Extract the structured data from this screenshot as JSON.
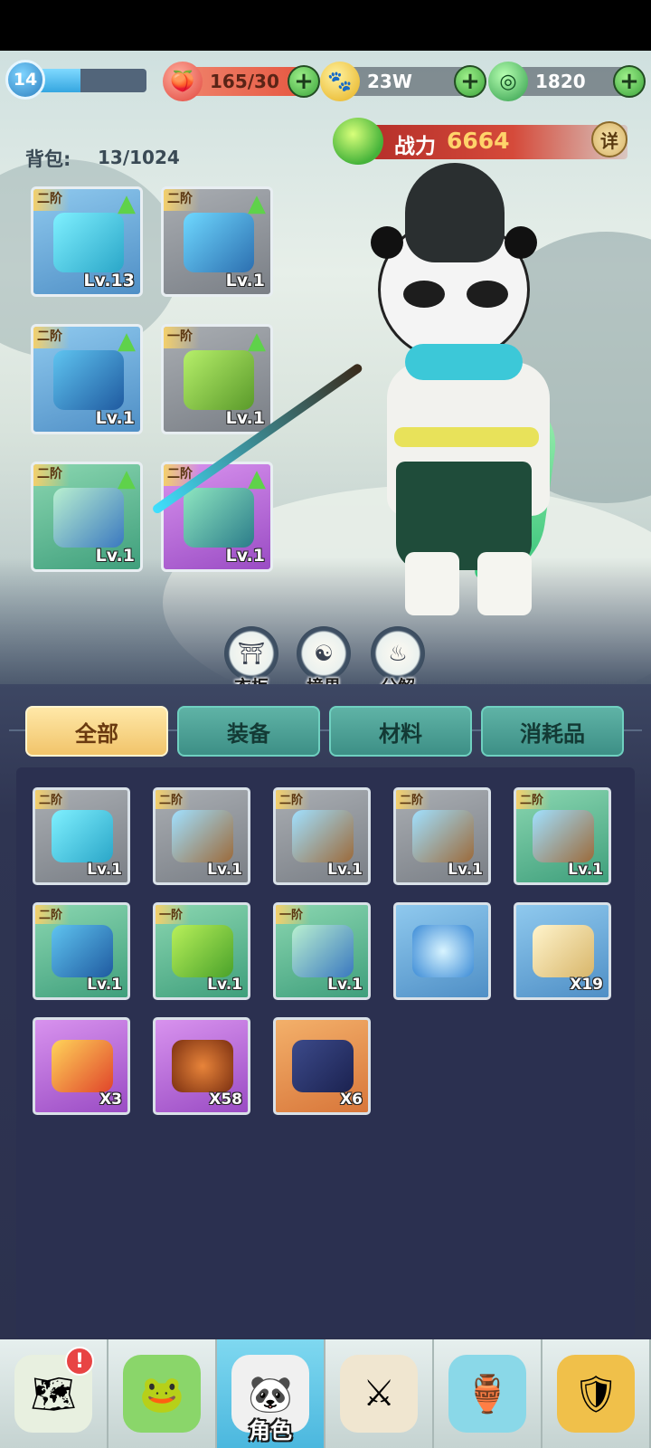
{
  "player": {
    "level": "14",
    "xp_fraction": 0.4
  },
  "resources": {
    "stamina": {
      "value": "165/30",
      "icon": "peach-icon"
    },
    "gold": {
      "value": "23W",
      "icon": "paw-coin-icon"
    },
    "jade": {
      "value": "1820",
      "icon": "jade-icon"
    }
  },
  "power": {
    "label": "战力",
    "value": "6664",
    "detail_label": "详"
  },
  "bag": {
    "label": "背包:",
    "count": "13/1024"
  },
  "equipment": [
    {
      "tier": "二阶",
      "level": "Lv.13",
      "kind": "sword",
      "bg": "blue",
      "upgrade": true
    },
    {
      "tier": "二阶",
      "level": "Lv.1",
      "kind": "shoulder",
      "bg": "gray",
      "upgrade": true
    },
    {
      "tier": "二阶",
      "level": "Lv.1",
      "kind": "armor",
      "bg": "blue",
      "upgrade": true
    },
    {
      "tier": "一阶",
      "level": "Lv.1",
      "kind": "belt",
      "bg": "gray",
      "upgrade": true
    },
    {
      "tier": "二阶",
      "level": "Lv.1",
      "kind": "bracer",
      "bg": "green",
      "upgrade": true
    },
    {
      "tier": "二阶",
      "level": "Lv.1",
      "kind": "boots",
      "bg": "purple",
      "upgrade": true
    }
  ],
  "functions": [
    {
      "label": "衣柜",
      "icon": "wardrobe-icon"
    },
    {
      "label": "境界",
      "icon": "realm-icon"
    },
    {
      "label": "分解",
      "icon": "decompose-icon"
    }
  ],
  "tabs": [
    {
      "label": "全部",
      "active": true
    },
    {
      "label": "装备",
      "active": false
    },
    {
      "label": "材料",
      "active": false
    },
    {
      "label": "消耗品",
      "active": false
    }
  ],
  "inventory": [
    {
      "tier": "二阶",
      "level": "Lv.1",
      "qty": "",
      "bg": "gray",
      "kind": "sword"
    },
    {
      "tier": "二阶",
      "level": "Lv.1",
      "qty": "",
      "bg": "gray",
      "kind": "quiver"
    },
    {
      "tier": "二阶",
      "level": "Lv.1",
      "qty": "",
      "bg": "gray",
      "kind": "quiver"
    },
    {
      "tier": "二阶",
      "level": "Lv.1",
      "qty": "",
      "bg": "gray",
      "kind": "quiver"
    },
    {
      "tier": "二阶",
      "level": "Lv.1",
      "qty": "",
      "bg": "green",
      "kind": "quiver"
    },
    {
      "tier": "二阶",
      "level": "Lv.1",
      "qty": "",
      "bg": "green",
      "kind": "armor"
    },
    {
      "tier": "一阶",
      "level": "Lv.1",
      "qty": "",
      "bg": "green",
      "kind": "helmet"
    },
    {
      "tier": "一阶",
      "level": "Lv.1",
      "qty": "",
      "bg": "green",
      "kind": "bracer"
    },
    {
      "tier": "",
      "level": "",
      "qty": "",
      "bg": "blue",
      "kind": "lotus"
    },
    {
      "tier": "",
      "level": "",
      "qty": "X19",
      "bg": "blue",
      "kind": "scroll"
    },
    {
      "tier": "",
      "level": "",
      "qty": "X3",
      "bg": "purple",
      "kind": "talisman"
    },
    {
      "tier": "",
      "level": "",
      "qty": "X58",
      "bg": "purple",
      "kind": "roast-chicken"
    },
    {
      "tier": "",
      "level": "",
      "qty": "X6",
      "bg": "orange",
      "kind": "book"
    }
  ],
  "nav": [
    {
      "label": "",
      "icon": "map-icon",
      "alert": "!"
    },
    {
      "label": "",
      "icon": "frog-coin-icon",
      "alert": ""
    },
    {
      "label": "角色",
      "icon": "panda-hat-icon",
      "alert": "",
      "active": true
    },
    {
      "label": "",
      "icon": "crossed-swords-icon",
      "alert": ""
    },
    {
      "label": "",
      "icon": "gourd-icon",
      "alert": ""
    },
    {
      "label": "",
      "icon": "shield-paw-icon",
      "alert": ""
    }
  ],
  "colors": {
    "blue_item": "#4f8fc6",
    "gray_item": "#7a7f86",
    "green_item": "#3f9f7c",
    "purple_item": "#9a4cc4",
    "orange_item": "#d8763a",
    "power_value": "#ffd36a"
  }
}
